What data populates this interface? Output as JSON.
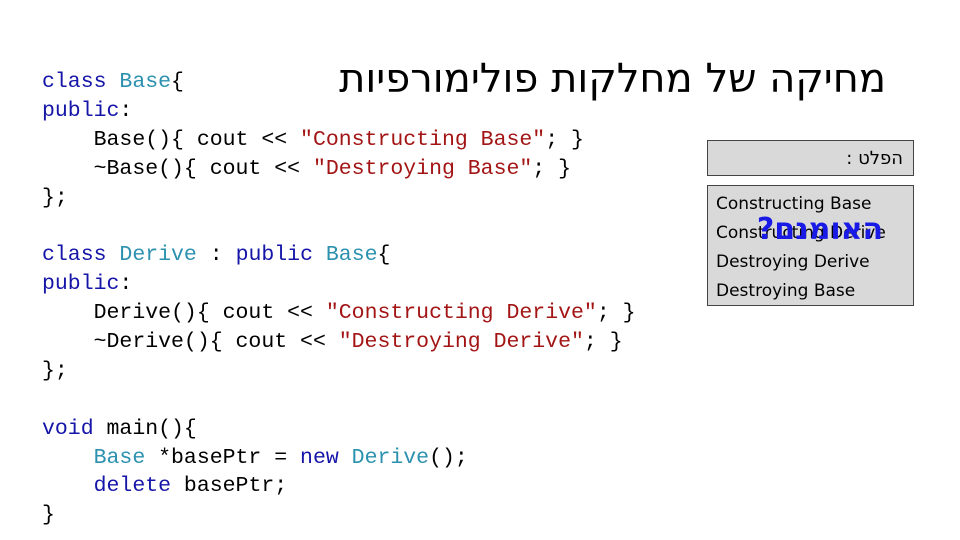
{
  "title": "מחיקה של מחלקות פולימורפיות",
  "code_lines": [
    [
      {
        "t": "class",
        "c": "kw"
      },
      {
        "t": " "
      },
      {
        "t": "Base",
        "c": "ty"
      },
      {
        "t": "{"
      }
    ],
    [
      {
        "t": "public",
        "c": "kw"
      },
      {
        "t": ":"
      }
    ],
    [
      {
        "t": "    Base(){ cout << "
      },
      {
        "t": "\"Constructing Base\"",
        "c": "st"
      },
      {
        "t": "; }"
      }
    ],
    [
      {
        "t": "    ~Base(){ cout << "
      },
      {
        "t": "\"Destroying Base\"",
        "c": "st"
      },
      {
        "t": "; }"
      }
    ],
    [
      {
        "t": "};"
      }
    ],
    [
      {
        "t": ""
      }
    ],
    [
      {
        "t": "class",
        "c": "kw"
      },
      {
        "t": " "
      },
      {
        "t": "Derive",
        "c": "ty"
      },
      {
        "t": " : "
      },
      {
        "t": "public",
        "c": "kw"
      },
      {
        "t": " "
      },
      {
        "t": "Base",
        "c": "ty"
      },
      {
        "t": "{"
      }
    ],
    [
      {
        "t": "public",
        "c": "kw"
      },
      {
        "t": ":"
      }
    ],
    [
      {
        "t": "    Derive(){ cout << "
      },
      {
        "t": "\"Constructing Derive\"",
        "c": "st"
      },
      {
        "t": "; }"
      }
    ],
    [
      {
        "t": "    ~Derive(){ cout << "
      },
      {
        "t": "\"Destroying Derive\"",
        "c": "st"
      },
      {
        "t": "; }"
      }
    ],
    [
      {
        "t": "};"
      }
    ],
    [
      {
        "t": ""
      }
    ],
    [
      {
        "t": "void",
        "c": "kw"
      },
      {
        "t": " main(){"
      }
    ],
    [
      {
        "t": "    "
      },
      {
        "t": "Base",
        "c": "ty"
      },
      {
        "t": " *basePtr = "
      },
      {
        "t": "new",
        "c": "kw"
      },
      {
        "t": " "
      },
      {
        "t": "Derive",
        "c": "ty"
      },
      {
        "t": "();"
      }
    ],
    [
      {
        "t": "    "
      },
      {
        "t": "delete",
        "c": "kw"
      },
      {
        "t": " basePtr;"
      }
    ],
    [
      {
        "t": "}"
      }
    ]
  ],
  "output_label": "הפלט :",
  "output_lines": [
    "Constructing Base",
    "Constructing Derive",
    "Destroying Derive",
    "Destroying Base"
  ],
  "overlay_text": "האומנם?",
  "colors": {
    "keyword": "#1515a8",
    "type": "#2b91af",
    "string": "#a31515",
    "overlay": "#1a1ae6",
    "box": "#d9d9d9"
  }
}
